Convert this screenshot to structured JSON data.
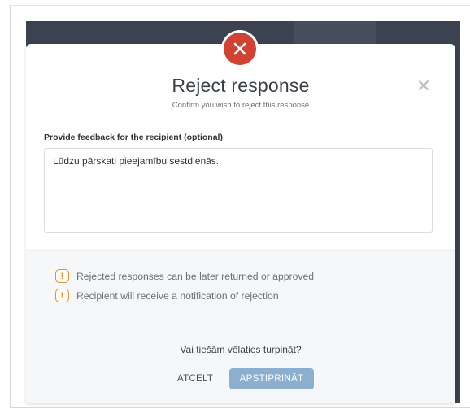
{
  "modal": {
    "title": "Reject response",
    "subtitle": "Confirm you wish to reject this response",
    "close_icon": "close-icon",
    "status_icon": "x-circle-icon",
    "accent_color": "#d14233"
  },
  "feedback": {
    "label": "Provide feedback for the recipient (optional)",
    "value": "Lūdzu pārskati pieejamību sestdienās."
  },
  "info": {
    "icon": "exclamation-icon",
    "icon_color": "#d99236",
    "items": [
      "Rejected responses can be later returned or approved",
      "Recipient will receive a notification of rejection"
    ]
  },
  "confirm": {
    "question": "Vai tiešām vēlaties turpināt?",
    "cancel_label": "ATCELT",
    "confirm_label": "APSTIPRINĀT",
    "confirm_color": "#8bb0cf"
  }
}
